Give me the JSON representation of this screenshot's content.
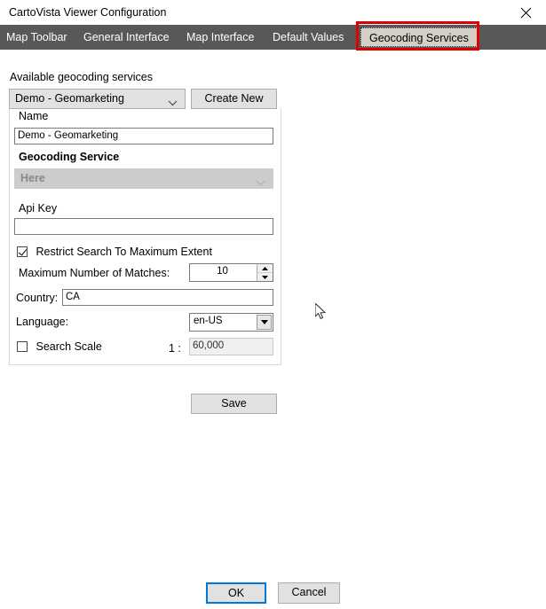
{
  "window": {
    "title": "CartoVista Viewer Configuration",
    "close_icon": "close-icon"
  },
  "tabs": [
    {
      "label": "Map Toolbar",
      "active": false
    },
    {
      "label": "General Interface",
      "active": false
    },
    {
      "label": "Map Interface",
      "active": false
    },
    {
      "label": "Default Values",
      "active": false
    },
    {
      "label": "Geocoding Services",
      "active": true
    }
  ],
  "form": {
    "available_label": "Available geocoding services",
    "service_select_value": "Demo - Geomarketing",
    "create_new_label": "Create New",
    "name_label": "Name",
    "name_value": "Demo - Geomarketing",
    "geocoding_service_label": "Geocoding Service",
    "geocoding_service_value": "Here",
    "api_key_label": "Api Key",
    "api_key_value": "",
    "restrict_label": "Restrict Search To Maximum Extent",
    "restrict_checked": true,
    "max_matches_label": "Maximum Number of Matches:",
    "max_matches_value": "10",
    "country_label": "Country:",
    "country_value": "CA",
    "language_label": "Language:",
    "language_value": "en-US",
    "search_scale_label": "Search Scale",
    "search_scale_checked": false,
    "scale_ratio_label": "1 :",
    "scale_value": "60,000",
    "save_label": "Save"
  },
  "footer": {
    "ok_label": "OK",
    "cancel_label": "Cancel"
  },
  "colors": {
    "tabbar_background": "#58585a",
    "active_tab_background": "#d4d0c8",
    "annotation_red": "#e00000",
    "focus_blue": "#0078d7"
  }
}
